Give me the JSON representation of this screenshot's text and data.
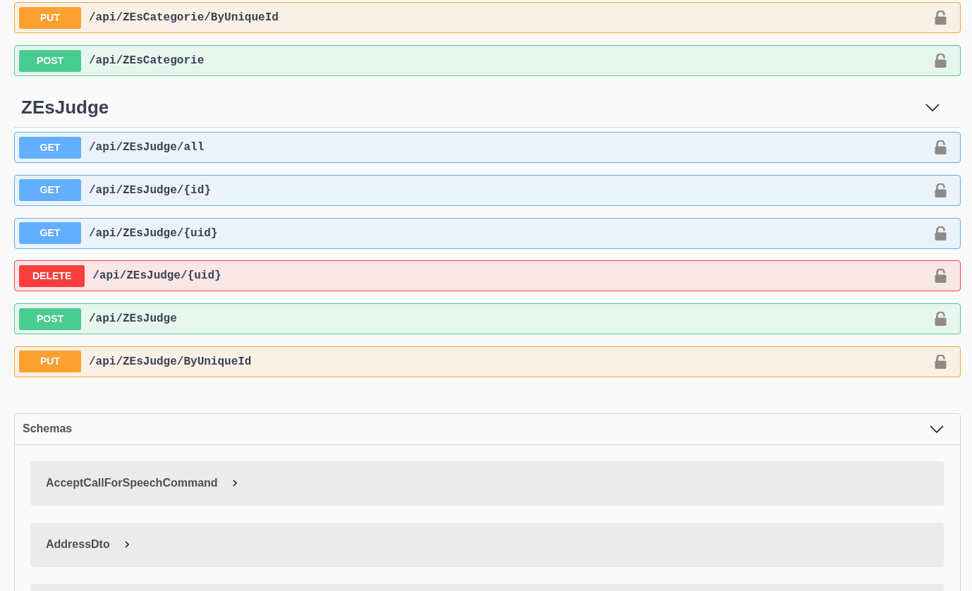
{
  "tags": [
    {
      "operations": [
        {
          "kind": "put",
          "method": "PUT",
          "path": "/api/ZEsCategorie/ByUniqueId"
        },
        {
          "kind": "post",
          "method": "POST",
          "path": "/api/ZEsCategorie"
        }
      ]
    },
    {
      "name": "ZEsJudge",
      "expanded": true,
      "operations": [
        {
          "kind": "get",
          "method": "GET",
          "path": "/api/ZEsJudge/all"
        },
        {
          "kind": "get",
          "method": "GET",
          "path": "/api/ZEsJudge/{id}"
        },
        {
          "kind": "get",
          "method": "GET",
          "path": "/api/ZEsJudge/{uid}"
        },
        {
          "kind": "delete",
          "method": "DELETE",
          "path": "/api/ZEsJudge/{uid}"
        },
        {
          "kind": "post",
          "method": "POST",
          "path": "/api/ZEsJudge"
        },
        {
          "kind": "put",
          "method": "PUT",
          "path": "/api/ZEsJudge/ByUniqueId"
        }
      ]
    }
  ],
  "schemas": {
    "title": "Schemas",
    "expanded": true,
    "models": [
      {
        "name": "AcceptCallForSpeechCommand",
        "expanded": false
      },
      {
        "name": "AddressDto",
        "expanded": false
      }
    ]
  }
}
